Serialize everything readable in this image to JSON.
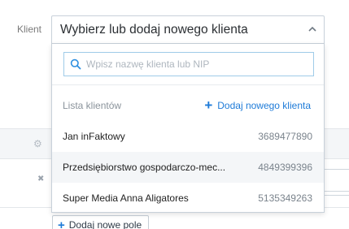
{
  "form": {
    "client_label": "Klient",
    "add_field_label": "Dodaj nowe pole"
  },
  "select": {
    "value": "Wybierz lub dodaj nowego klienta"
  },
  "search": {
    "placeholder": "Wpisz nazwę klienta lub NIP",
    "value": ""
  },
  "list": {
    "title": "Lista klientów",
    "add_label": "Dodaj nowego klienta",
    "clients": [
      {
        "name": "Jan inFaktowy",
        "nip": "3689477890"
      },
      {
        "name": "Przedsiębiorstwo gospodarczo-mec...",
        "nip": "4849399396"
      },
      {
        "name": "Super Media Anna Aligatores",
        "nip": "5135349263"
      }
    ]
  },
  "icons": {
    "search": "search-icon",
    "chevron": "chevron-up-icon",
    "gear": "gear-icon",
    "remove": "close-icon",
    "plus": "plus-icon"
  },
  "colors": {
    "accent": "#1e7bd8",
    "search_border": "#9fcbe8",
    "row_alt": "#f4f6f8"
  }
}
